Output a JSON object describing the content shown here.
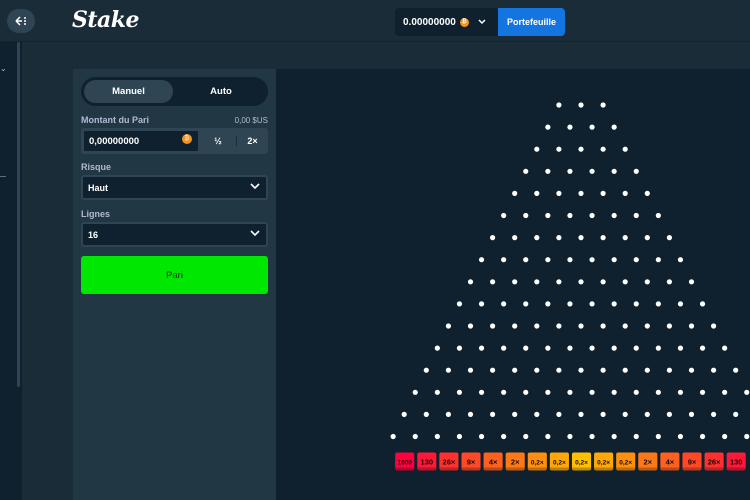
{
  "header": {
    "logo": "Stake",
    "balance": "0.00000000",
    "wallet_label": "Portefeuille"
  },
  "panel": {
    "mode_tabs": [
      "Manuel",
      "Auto"
    ],
    "bet_amount_label": "Montant du Pari",
    "bet_amount_usd": "0,00 $US",
    "bet_amount_value": "0,00000000",
    "half_label": "½",
    "double_label": "2×",
    "risk_label": "Risque",
    "risk_value": "Haut",
    "rows_label": "Lignes",
    "rows_value": "16",
    "play_label": "Pari"
  },
  "board": {
    "rows": 16,
    "multipliers": [
      "1000",
      "130",
      "26×",
      "9×",
      "4×",
      "2×",
      "0,2×",
      "0,2×",
      "0,2×",
      "0,2×",
      "0,2×",
      "2×",
      "4×",
      "9×",
      "26×",
      "130"
    ],
    "slot_colors": [
      "#ff003f",
      "#ff1837",
      "#ff302f",
      "#ff4827",
      "#ff601f",
      "#ff7817",
      "#ff900f",
      "#ffa807",
      "#ffc000",
      "#ffa807",
      "#ff900f",
      "#ff7817",
      "#ff601f",
      "#ff4827",
      "#ff302f",
      "#ff1837"
    ]
  },
  "colors": {
    "accent_green": "#00e701",
    "wallet_blue": "#1475e1",
    "coin_orange": "#f7931a"
  }
}
